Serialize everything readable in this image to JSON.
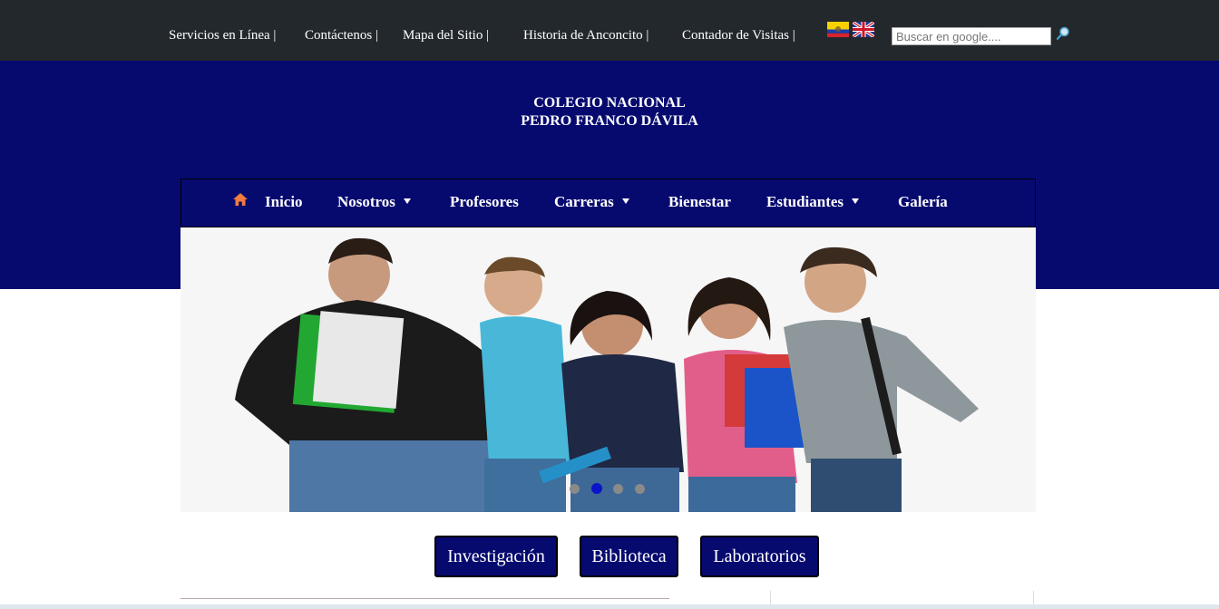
{
  "topbar": {
    "links": [
      {
        "label": "Servicios en Línea |"
      },
      {
        "label": "Contáctenos |"
      },
      {
        "label": "Mapa del Sitio   |"
      },
      {
        "label": "Historia de Anconcito   |"
      },
      {
        "label": "Contador de Visitas   |"
      }
    ],
    "flags": [
      "ecuador-flag-icon",
      "uk-flag-icon"
    ],
    "search_placeholder": "Buscar en google....",
    "search_icon": "search-icon"
  },
  "header": {
    "title_line1": "COLEGIO NACIONAL",
    "title_line2": "PEDRO FRANCO DÁVILA"
  },
  "nav": {
    "items": [
      {
        "label": "Inicio"
      },
      {
        "label": "Nosotros",
        "dropdown": true
      },
      {
        "label": "Profesores"
      },
      {
        "label": "Carreras",
        "dropdown": true
      },
      {
        "label": "Bienestar"
      },
      {
        "label": "Estudiantes",
        "dropdown": true
      },
      {
        "label": "Galería"
      }
    ],
    "home_icon": "home-icon"
  },
  "slider": {
    "slide_count": 4,
    "active_index": 1,
    "image_description": "students-group-photo"
  },
  "quick_links": [
    {
      "label": "Investigación"
    },
    {
      "label": "Biblioteca"
    },
    {
      "label": "Laboratorios"
    }
  ],
  "colors": {
    "topbar": "#23282d",
    "brand_blue": "#060a6f",
    "active_dot": "#0a14c8",
    "home_icon": "#f07a40"
  }
}
